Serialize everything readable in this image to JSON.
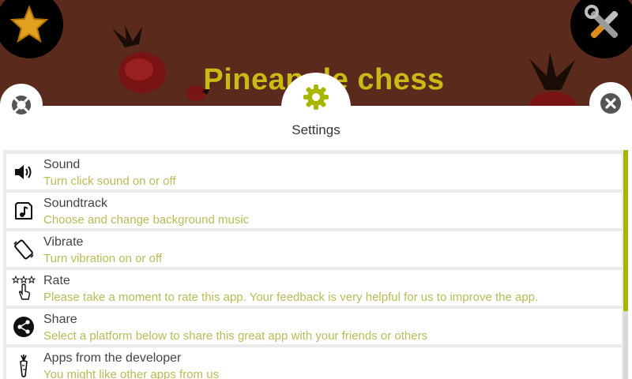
{
  "background": {
    "game_title": "Pineapple chess",
    "colors": {
      "bg": "#5a2a1c",
      "title": "#c9bb16"
    }
  },
  "top_buttons": {
    "left_icon": "star-icon",
    "right_icon": "tools-icon"
  },
  "panel": {
    "title": "Settings",
    "header_icon": "gear-icon",
    "left_icon": "help-lifebuoy-icon",
    "right_icon": "close-icon",
    "accent": "#a8b600"
  },
  "settings": {
    "items": [
      {
        "icon": "speaker-icon",
        "title": "Sound",
        "subtitle": "Turn click sound on or off"
      },
      {
        "icon": "music-note-icon",
        "title": "Soundtrack",
        "subtitle": "Choose and change background music"
      },
      {
        "icon": "vibrate-phone-icon",
        "title": "Vibrate",
        "subtitle": "Turn vibration on or off"
      },
      {
        "icon": "rate-stars-hand-icon",
        "title": "Rate",
        "subtitle": "Please take a moment to rate this app. Your feedback is very helpful for us to improve the app."
      },
      {
        "icon": "share-icon",
        "title": "Share",
        "subtitle": "Select a platform below to share this great app with your friends or others"
      },
      {
        "icon": "carrot-icon",
        "title": "Apps from the developer",
        "subtitle": "You might like other apps from us"
      }
    ]
  }
}
